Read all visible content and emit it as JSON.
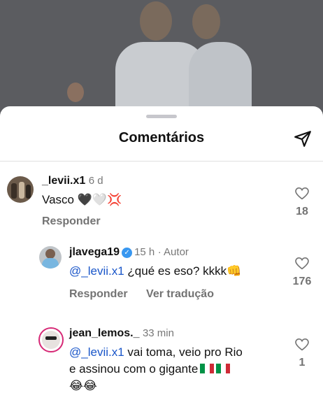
{
  "sheet": {
    "title": "Comentários"
  },
  "comments": [
    {
      "username": "_levii.x1",
      "time": "6 d",
      "text": "Vasco",
      "emojis": "🖤🤍💢",
      "reply_label": "Responder",
      "likes": "18"
    },
    {
      "username": "jlavega19",
      "verified": true,
      "time": "15 h",
      "author_tag": "· Autor",
      "mention": "@_levii.x1",
      "text": "¿qué es eso? kkkk",
      "emojis": "👊",
      "reply_label": "Responder",
      "translate_label": "Ver tradução",
      "likes": "176"
    },
    {
      "username": "jean_lemos._",
      "time": "33 min",
      "mention": "@_levii.x1",
      "text_line1": "vai toma, veio pro Rio",
      "text_line2": "e assinou com o gigante",
      "emojis_line3": "😂😂",
      "likes": "1"
    }
  ],
  "colors": {
    "mention": "#1a56c9",
    "verified": "#3897f0",
    "muted": "#737373"
  },
  "icons": [
    "send-icon",
    "heart-icon",
    "verified-icon"
  ]
}
